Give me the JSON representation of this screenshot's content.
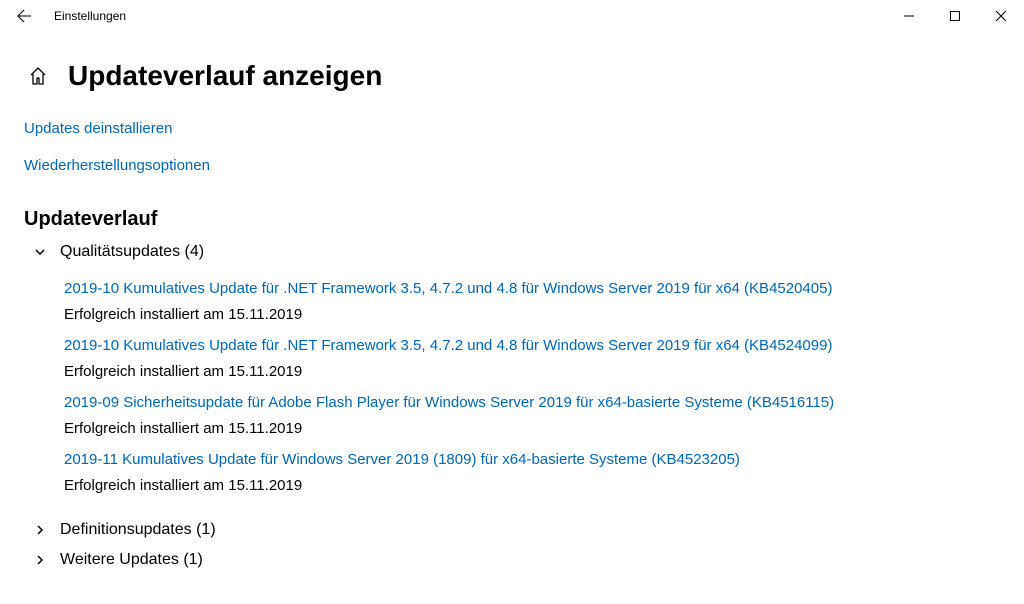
{
  "app_title": "Einstellungen",
  "page_title": "Updateverlauf anzeigen",
  "links": {
    "uninstall": "Updates deinstallieren",
    "recovery": "Wiederherstellungsoptionen"
  },
  "history_header": "Updateverlauf",
  "categories": [
    {
      "label": "Qualitätsupdates (4)",
      "expanded": true,
      "items": [
        {
          "title": "2019-10 Kumulatives Update für .NET Framework 3.5, 4.7.2 und 4.8 für Windows Server 2019 für x64 (KB4520405)",
          "status": "Erfolgreich installiert am 15.11.2019"
        },
        {
          "title": "2019-10 Kumulatives Update für .NET Framework 3.5, 4.7.2 und 4.8 für Windows Server 2019 für x64 (KB4524099)",
          "status": "Erfolgreich installiert am 15.11.2019"
        },
        {
          "title": "2019-09 Sicherheitsupdate für Adobe Flash Player für Windows Server 2019 für x64-basierte Systeme (KB4516115)",
          "status": "Erfolgreich installiert am 15.11.2019"
        },
        {
          "title": "2019-11 Kumulatives Update für Windows Server 2019 (1809) für x64-basierte Systeme (KB4523205)",
          "status": "Erfolgreich installiert am 15.11.2019"
        }
      ]
    },
    {
      "label": "Definitionsupdates (1)",
      "expanded": false
    },
    {
      "label": "Weitere Updates (1)",
      "expanded": false
    }
  ]
}
